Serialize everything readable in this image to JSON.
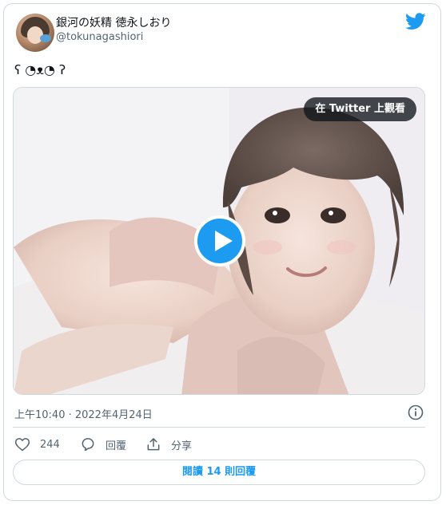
{
  "author": {
    "display_name": "銀河の妖精 徳永しおり",
    "handle": "@tokunagashiori"
  },
  "tweet": {
    "text": "ʕ ◔ᴥ◔ ʔ",
    "timestamp": "上午10:40 · 2022年4月24日"
  },
  "media": {
    "watch_label": "在 Twitter 上觀看"
  },
  "actions": {
    "like_count": "244",
    "reply_label": "回覆",
    "share_label": "分享"
  },
  "read_replies_label": "閱讀 14 則回覆",
  "colors": {
    "brand": "#1d9bf0",
    "text": "#0f1419",
    "muted": "#536471",
    "border": "#cfd9de"
  },
  "icons": {
    "logo": "twitter-bird-icon",
    "info": "info-icon",
    "like": "heart-icon",
    "reply": "speech-bubble-icon",
    "share": "share-upload-icon",
    "play": "play-icon"
  }
}
